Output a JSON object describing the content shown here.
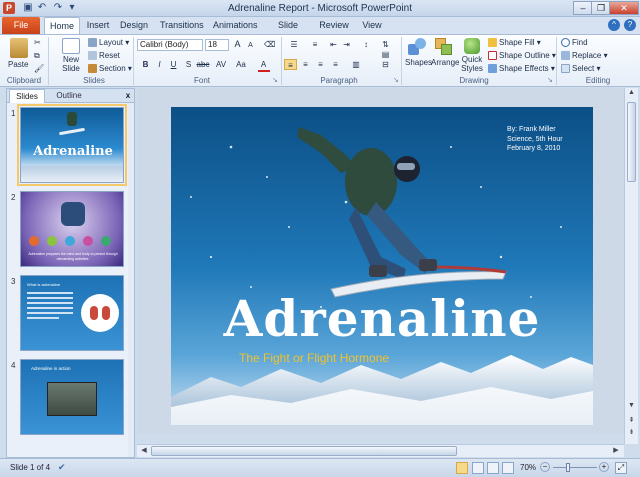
{
  "window": {
    "title": "Adrenaline Report  -  Microsoft PowerPoint",
    "app_icon": "P",
    "qat": [
      "save-icon",
      "undo-icon",
      "redo-icon",
      "customize-icon"
    ],
    "controls": {
      "minimize": "–",
      "restore": "❐",
      "close": "✕"
    }
  },
  "tabs": [
    "File",
    "Home",
    "Insert",
    "Design",
    "Transitions",
    "Animations",
    "Slide Show",
    "Review",
    "View"
  ],
  "ribbon": {
    "clipboard": {
      "label": "Clipboard",
      "paste": "Paste"
    },
    "slides": {
      "label": "Slides",
      "new_slide": "New Slide",
      "layout": "Layout",
      "reset": "Reset",
      "section": "Section"
    },
    "font": {
      "label": "Font",
      "font_name": "Calibri (Body)",
      "font_size": "18",
      "bold": "B",
      "italic": "I",
      "underline": "U",
      "strike": "S",
      "shadow": "abc",
      "spacing": "AV",
      "case": "Aa",
      "color": "A",
      "grow": "A",
      "shrink": "A"
    },
    "paragraph": {
      "label": "Paragraph"
    },
    "drawing": {
      "label": "Drawing",
      "shapes": "Shapes",
      "arrange": "Arrange",
      "quick_styles": "Quick Styles",
      "shape_fill": "Shape Fill",
      "shape_outline": "Shape Outline",
      "shape_effects": "Shape Effects"
    },
    "editing": {
      "label": "Editing",
      "find": "Find",
      "replace": "Replace",
      "select": "Select"
    }
  },
  "pane": {
    "tabs": [
      "Slides",
      "Outline"
    ],
    "close": "x",
    "thumbnails": [
      {
        "number": "1",
        "title": "Adrenaline"
      },
      {
        "number": "2",
        "title": "Adrenaline prepares the mind and body to persist through demanding activities."
      },
      {
        "number": "3",
        "title": "What is adrenaline"
      },
      {
        "number": "4",
        "title": "Adrenaline in action"
      }
    ]
  },
  "slide": {
    "author": "By: Frank Miller",
    "class": "Science, 5th Hour",
    "date": "February 8, 2010",
    "title": "Adrenaline",
    "subtitle": "The Fight or Flight Hormone"
  },
  "status": {
    "slide_indicator": "Slide 1 of 4",
    "zoom": "70%",
    "zoom_level": 0.7
  },
  "colors": {
    "file_tab": "#d4541f",
    "subtitle": "#f2c22a",
    "sky": "#1b6ca8"
  }
}
